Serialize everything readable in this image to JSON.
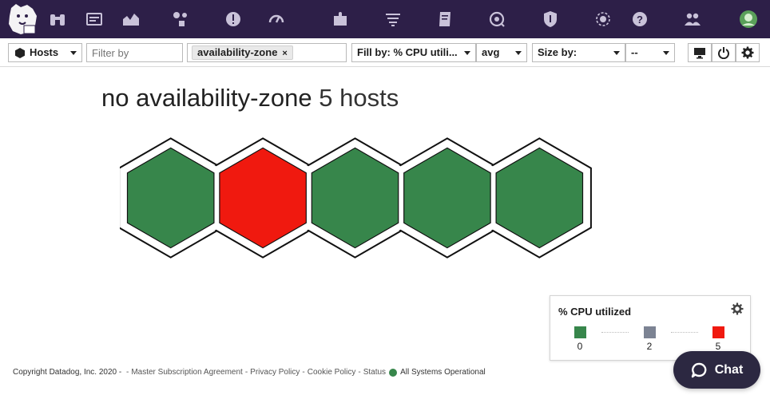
{
  "nav": {
    "items": [
      {
        "icon": "binoculars-icon"
      },
      {
        "icon": "dashboard-icon"
      },
      {
        "icon": "metrics-icon"
      },
      {
        "icon": "infrastructure-icon"
      },
      {
        "icon": "monitors-icon"
      },
      {
        "icon": "apm-icon"
      },
      {
        "icon": "integrations-icon"
      },
      {
        "icon": "logs-icon"
      },
      {
        "icon": "notebooks-icon"
      },
      {
        "icon": "synthetics-icon"
      },
      {
        "icon": "security-icon"
      },
      {
        "icon": "rum-icon"
      },
      {
        "icon": "help-icon"
      },
      {
        "icon": "team-icon"
      },
      {
        "icon": "user-avatar"
      }
    ]
  },
  "toolbar": {
    "hosts_label": "Hosts",
    "filter_placeholder": "Filter by",
    "group_tag": "availability-zone",
    "group_tag_remove": "×",
    "fill_label": "Fill by: % CPU utili...",
    "agg_label": "avg",
    "size_label": "Size by:",
    "size_value": "--"
  },
  "main": {
    "group_title_prefix": "no availability-zone",
    "group_title_count": "5 hosts",
    "hosts": [
      {
        "status": "green",
        "cpu_bucket": 0
      },
      {
        "status": "red",
        "cpu_bucket": 5
      },
      {
        "status": "green",
        "cpu_bucket": 0
      },
      {
        "status": "green",
        "cpu_bucket": 0
      },
      {
        "status": "green",
        "cpu_bucket": 0
      }
    ]
  },
  "legend": {
    "title": "% CPU utilized",
    "stops": [
      {
        "label": "0",
        "color": "#37864b"
      },
      {
        "label": "2",
        "color": "#7c8393"
      },
      {
        "label": "5",
        "color": "#f0190f"
      }
    ]
  },
  "footer": {
    "copyright": "Copyright Datadog, Inc. 2020 -",
    "links": [
      "Master Subscription Agreement",
      "Privacy Policy",
      "Cookie Policy",
      "Status"
    ],
    "status_text": "All Systems Operational",
    "status_color": "#37864b"
  },
  "chat": {
    "label": "Chat"
  },
  "colors": {
    "nav_bg": "#2d1f48",
    "host_green": "#37864b",
    "host_red": "#f0190f"
  }
}
